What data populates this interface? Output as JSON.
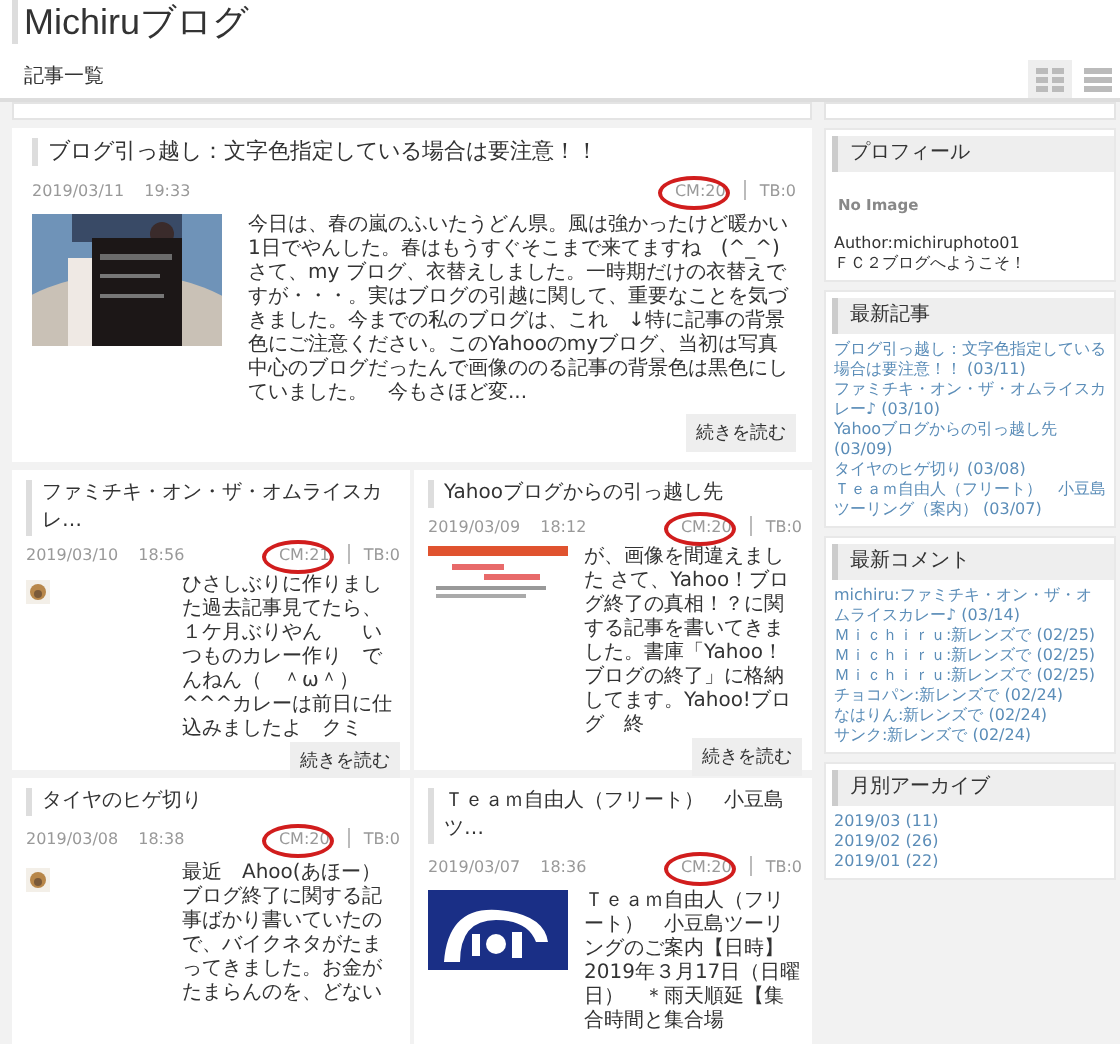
{
  "blog_title": "Michiruブログ",
  "section_title": "記事一覧",
  "view_toggles": [
    {
      "kind": "grid",
      "selected": true
    },
    {
      "kind": "list",
      "selected": false
    }
  ],
  "articles": [
    {
      "title": "ブログ引っ越し：文字色指定している場合は要注意！！",
      "date": "2019/03/11",
      "time": "19:33",
      "comments": "CM:20",
      "trackbacks": "TB:0",
      "circled": true,
      "excerpt": "今日は、春の嵐のふいたうどん県。風は強かったけど暖かい1日でやんした。春はもうすぐそこまで来てますね　(^_^)さて、my ブログ、衣替えしました。一時期だけの衣替えですが・・・。実はブログの引越に関して、重要なことを気づきました。今までの私のブログは、これ　↓特に記事の背景色にご注意ください。このYahooのmyブログ、当初は写真中心のブログだったんで画像ののる記事の背景色は黒色にしていました。　今もさほど変...",
      "more": "続きを読む"
    },
    {
      "title": "ファミチキ・オン・ザ・オムライスカレ…",
      "date": "2019/03/10",
      "time": "18:56",
      "comments": "CM:21",
      "trackbacks": "TB:0",
      "circled": true,
      "excerpt": "ひさしぶりに作りました過去記事見てたら、１ケ月ぶりやん　　いつものカレー作り　でんねん（　＾ω＾）^^^カレーは前日に仕込みましたよ　クミ",
      "more": "続きを読む"
    },
    {
      "title": "Yahooブログからの引っ越し先",
      "date": "2019/03/09",
      "time": "18:12",
      "comments": "CM:20",
      "trackbacks": "TB:0",
      "circled": true,
      "excerpt": "が、画像を間違えました さて、Yahoo！ブログ終了の真相！？に関する記事を書いてきました。書庫「Yahoo！ブログの終了」に格納してます。Yahoo!ブログ　終",
      "more": "続きを読む"
    },
    {
      "title": "タイヤのヒゲ切り",
      "date": "2019/03/08",
      "time": "18:38",
      "comments": "CM:20",
      "trackbacks": "TB:0",
      "circled": true,
      "excerpt": "最近　Ahoo(あほー）ブログ終了に関する記事ばかり書いていたので、バイクネタがたまってきました。お金がたまらんのを、どない"
    },
    {
      "title": "Ｔｅａｍ自由人（フリート）　小豆島ツ…",
      "date": "2019/03/07",
      "time": "18:36",
      "comments": "CM:20",
      "trackbacks": "TB:0",
      "circled": true,
      "excerpt": "Ｔｅａｍ自由人（フリート）　小豆島ツーリングのご案内【日時】　2019年３月17日（日曜日）　＊雨天順延【集合時間と集合場"
    }
  ],
  "sidebar": [
    {
      "kind": "profile",
      "title": "プロフィール",
      "no_image": "No Image",
      "author": "Author:michiruphoto01",
      "greeting": "ＦＣ２ブログへようこそ！"
    },
    {
      "kind": "links",
      "title": "最新記事",
      "items": [
        "ブログ引っ越し：文字色指定している場合は要注意！！ (03/11)",
        "ファミチキ・オン・ザ・オムライスカレー♪ (03/10)",
        "Yahooブログからの引っ越し先 (03/09)",
        "タイヤのヒゲ切り (03/08)",
        "Ｔｅａｍ自由人（フリート）　小豆島ツーリング（案内） (03/07)"
      ]
    },
    {
      "kind": "links",
      "title": "最新コメント",
      "items": [
        "michiru:ファミチキ・オン・ザ・オムライスカレー♪ (03/14)",
        "Ｍｉｃｈｉｒｕ:新レンズで (02/25)",
        "Ｍｉｃｈｉｒｕ:新レンズで (02/25)",
        "Ｍｉｃｈｉｒｕ:新レンズで (02/25)",
        "チョコパン:新レンズで (02/24)",
        "なはりん:新レンズで (02/24)",
        "サンク:新レンズで (02/24)"
      ]
    },
    {
      "kind": "links",
      "title": "月別アーカイブ",
      "items": [
        "2019/03 (11)",
        "2019/02 (26)",
        "2019/01 (22)"
      ]
    }
  ]
}
